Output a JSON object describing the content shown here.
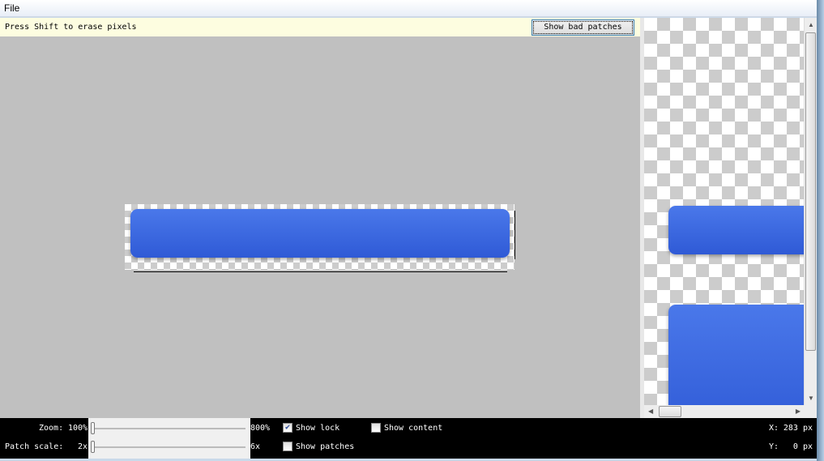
{
  "menu": {
    "file": "File"
  },
  "infobar": {
    "hint": "Press Shift to erase pixels",
    "show_bad_patches": "Show bad patches"
  },
  "controls": {
    "zoom_label": "Zoom:",
    "zoom_min": "100%",
    "zoom_max": "800%",
    "zoom_value_percent": 100,
    "patch_scale_label": "Patch scale:",
    "patch_min": "2x",
    "patch_max": "6x",
    "patch_value": 2,
    "show_lock": "Show lock",
    "show_lock_checked": true,
    "show_content": "Show content",
    "show_content_checked": false,
    "show_patches": "Show patches",
    "show_patches_checked": false
  },
  "coords": {
    "x_label": "X:",
    "x_value": "283 px",
    "y_label": "Y:",
    "y_value": "0 px"
  },
  "colors": {
    "button_blue": "#3a66e0",
    "canvas": "#c0c0c0",
    "infobar": "#fdfde0"
  }
}
